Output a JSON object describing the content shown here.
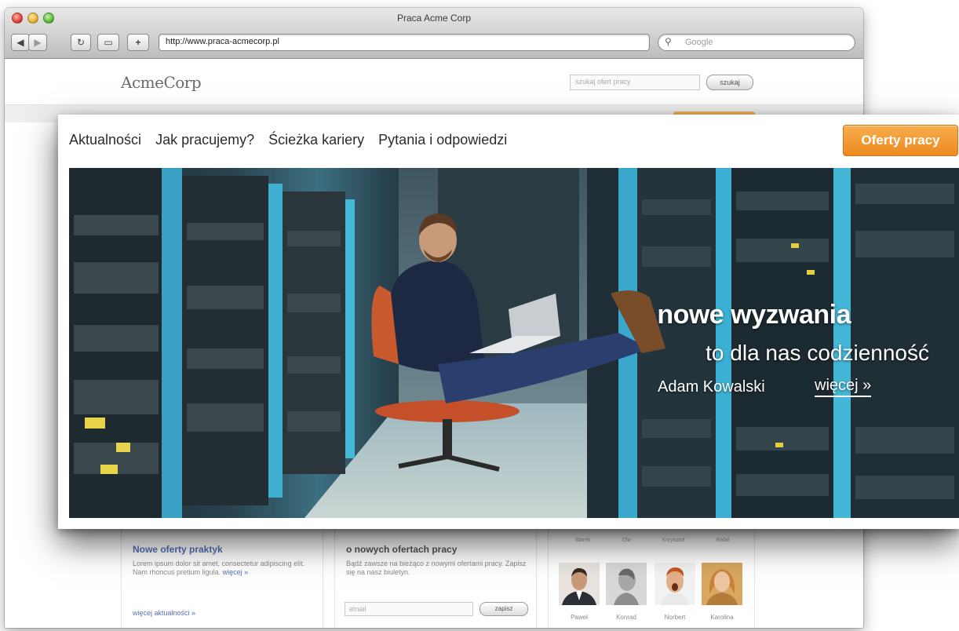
{
  "browser": {
    "window_title": "Praca Acme Corp",
    "url": "http://www.praca-acmecorp.pl",
    "search_placeholder": "Google"
  },
  "site": {
    "logo": "AcmeCorp",
    "search_placeholder": "szukaj ofert pracy",
    "search_button": "szukaj"
  },
  "nav": {
    "items": [
      {
        "label": "Aktualności"
      },
      {
        "label": "Jak pracujemy?"
      },
      {
        "label": "Ścieżka kariery"
      },
      {
        "label": "Pytania i odpowiedzi"
      }
    ],
    "cta": "Oferty pracy"
  },
  "hero": {
    "headline": "nowe wyzwania",
    "subline": "to dla nas codzienność",
    "byline": "Adam Kowalski",
    "more_link": "więcej »"
  },
  "columns": {
    "news": {
      "title": "Nowe oferty praktyk",
      "text": "Lorem ipsum dolor sit amet, consectetur adipiscing elit. Nam rhoncus pretium ligula.",
      "inline_link": "więcej »",
      "footer_link": "więcej aktualności »"
    },
    "newsletter": {
      "title": "o nowych ofertach pracy",
      "text": "Bądź zawsze na bieżąco z nowymi ofertami pracy. Zapisz się na nasz biuletyn.",
      "email_placeholder": "email",
      "button": "zapisz"
    },
    "people": {
      "top_names": [
        "Marek",
        "Ola",
        "Krzysztof",
        "Rafał"
      ],
      "names": [
        "Paweł",
        "Konrad",
        "Norbert",
        "Karolina"
      ]
    }
  },
  "colors": {
    "accent_orange": "#ee8a1f",
    "link_blue": "#5570b8"
  }
}
